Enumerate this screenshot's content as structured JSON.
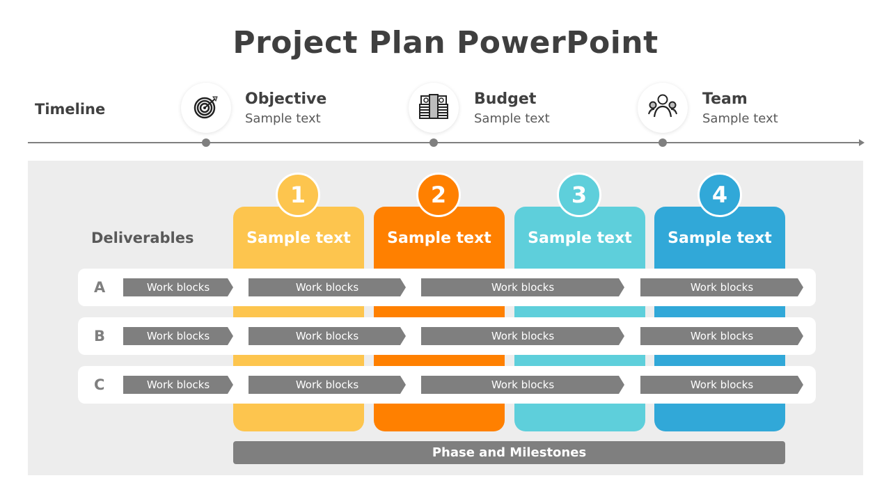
{
  "title": "Project Plan PowerPoint",
  "timeline": {
    "label": "Timeline",
    "milestones": [
      {
        "icon": "target-icon",
        "title": "Objective",
        "subtitle": "Sample text"
      },
      {
        "icon": "money-stack-icon",
        "title": "Budget",
        "subtitle": "Sample text"
      },
      {
        "icon": "team-icon",
        "title": "Team",
        "subtitle": "Sample text"
      }
    ]
  },
  "deliverables_label": "Deliverables",
  "phases": [
    {
      "number": "1",
      "label": "Sample text",
      "color": "#fdc54e"
    },
    {
      "number": "2",
      "label": "Sample text",
      "color": "#ff8000"
    },
    {
      "number": "3",
      "label": "Sample text",
      "color": "#5ecfdb"
    },
    {
      "number": "4",
      "label": "Sample text",
      "color": "#31a8d8"
    }
  ],
  "rows": [
    {
      "label": "A",
      "blocks": [
        "Work blocks",
        "Work blocks",
        "Work blocks",
        "Work blocks"
      ]
    },
    {
      "label": "B",
      "blocks": [
        "Work blocks",
        "Work blocks",
        "Work blocks",
        "Work blocks"
      ]
    },
    {
      "label": "C",
      "blocks": [
        "Work blocks",
        "Work blocks",
        "Work blocks",
        "Work blocks"
      ]
    }
  ],
  "footer_bar": "Phase and Milestones",
  "colors": {
    "accent_gray": "#7f7f7f",
    "panel_bg": "#ededed"
  }
}
